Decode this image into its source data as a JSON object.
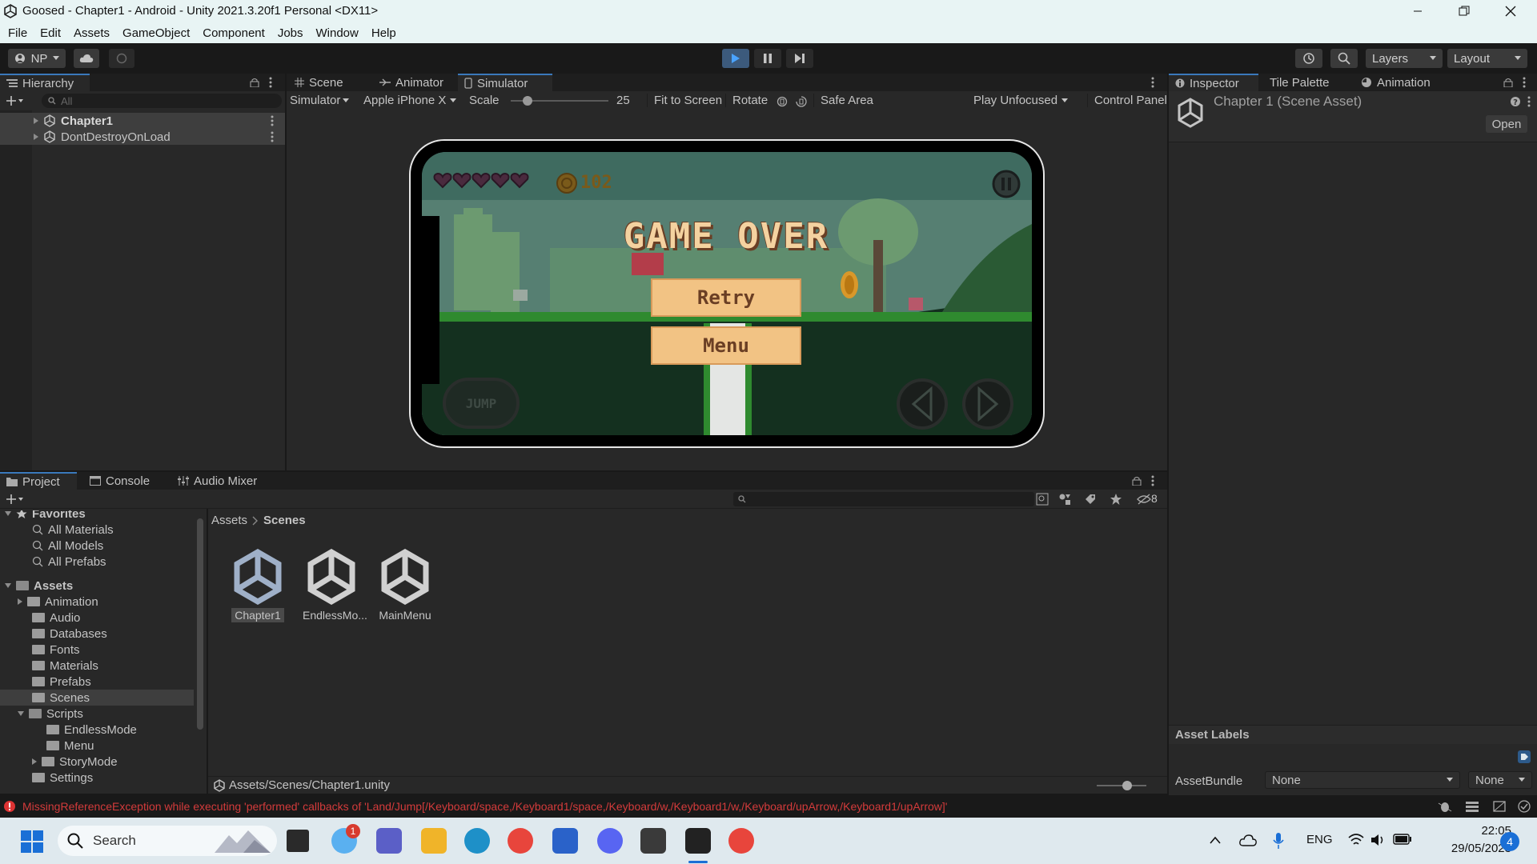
{
  "window": {
    "title": "Goosed - Chapter1 - Android - Unity 2021.3.20f1 Personal <DX11>"
  },
  "menubar": [
    "File",
    "Edit",
    "Assets",
    "GameObject",
    "Component",
    "Jobs",
    "Window",
    "Help"
  ],
  "toolbar": {
    "account": "NP",
    "layers": "Layers",
    "layout": "Layout"
  },
  "hierarchy": {
    "tab": "Hierarchy",
    "search_placeholder": "All",
    "items": [
      "Chapter1",
      "DontDestroyOnLoad"
    ]
  },
  "center_tabs": [
    "Scene",
    "Animator",
    "Simulator"
  ],
  "simulator_bar": {
    "mode": "Simulator",
    "device": "Apple iPhone X",
    "scale_label": "Scale",
    "scale_value": "25",
    "fit": "Fit to Screen",
    "rotate": "Rotate",
    "safe_area": "Safe Area",
    "play_mode": "Play Unfocused",
    "control_panel": "Control Panel"
  },
  "game": {
    "coins": "102",
    "title": "GAME OVER",
    "retry": "Retry",
    "menu": "Menu",
    "jump": "JUMP",
    "hearts": 5
  },
  "inspector": {
    "tabs": [
      "Inspector",
      "Tile Palette",
      "Animation"
    ],
    "asset_title": "Chapter 1 (Scene Asset)",
    "open_button": "Open",
    "asset_labels": "Asset Labels",
    "assetbundle_label": "AssetBundle",
    "assetbundle_value": "None",
    "variant_value": "None"
  },
  "bottom_tabs": [
    "Project",
    "Console",
    "Audio Mixer"
  ],
  "project": {
    "favorites_label": "Favorites",
    "favorites": [
      "All Materials",
      "All Models",
      "All Prefabs"
    ],
    "assets_label": "Assets",
    "folders": [
      "Animation",
      "Audio",
      "Databases",
      "Fonts",
      "Materials",
      "Prefabs",
      "Scenes",
      "Scripts"
    ],
    "script_folders": [
      "EndlessMode",
      "Menu",
      "StoryMode"
    ],
    "last_folder": "Settings",
    "breadcrumb": [
      "Assets",
      "Scenes"
    ],
    "files": [
      "Chapter1",
      "EndlessMo...",
      "MainMenu"
    ],
    "path": "Assets/Scenes/Chapter1.unity",
    "hidden_count": "8"
  },
  "status": {
    "error": "MissingReferenceException while executing 'performed' callbacks of 'Land/Jump[/Keyboard/space,/Keyboard1/space,/Keyboard/w,/Keyboard1/w,/Keyboard/upArrow,/Keyboard1/upArrow]'"
  },
  "taskbar": {
    "search": "Search",
    "weather_badge": "1",
    "lang": "ENG",
    "time": "22:05",
    "date": "29/05/2023",
    "notif": "4"
  }
}
